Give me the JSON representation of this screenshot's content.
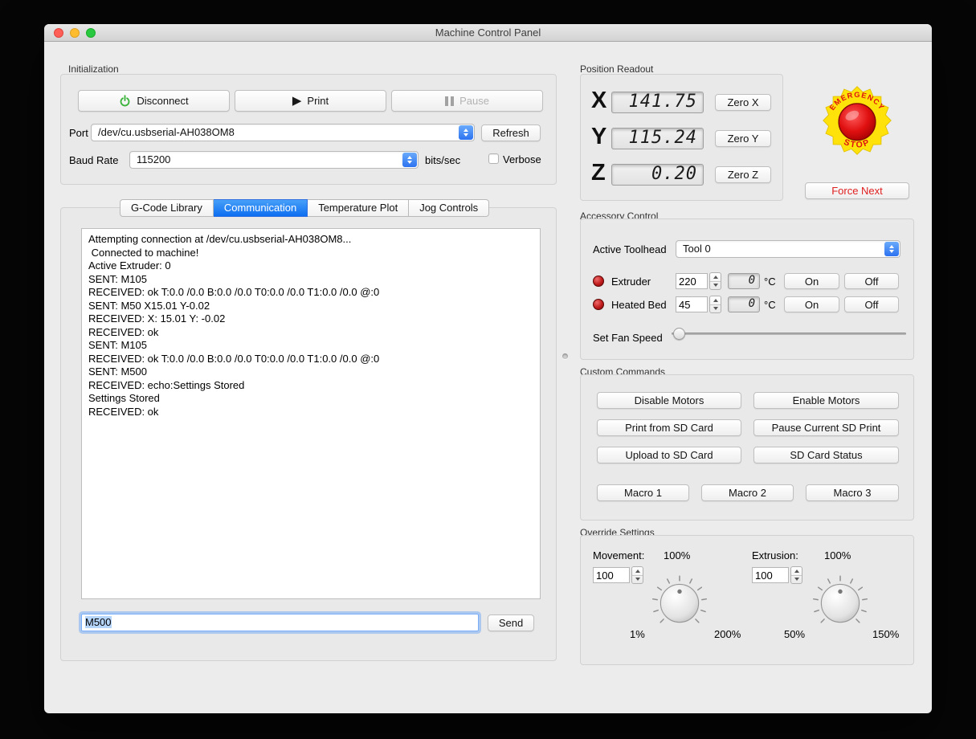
{
  "window": {
    "title": "Machine Control Panel"
  },
  "initialization": {
    "label": "Initialization",
    "disconnect_label": "Disconnect",
    "print_label": "Print",
    "pause_label": "Pause",
    "port_label": "Port",
    "port_value": "/dev/cu.usbserial-AH038OM8",
    "refresh_label": "Refresh",
    "baud_label": "Baud Rate",
    "baud_value": "115200",
    "baud_units": "bits/sec",
    "verbose_label": "Verbose"
  },
  "tabs": {
    "items": [
      {
        "label": "G-Code Library"
      },
      {
        "label": "Communication"
      },
      {
        "label": "Temperature Plot"
      },
      {
        "label": "Jog Controls"
      }
    ]
  },
  "console": {
    "log": "Attempting connection at /dev/cu.usbserial-AH038OM8...\n Connected to machine!\nActive Extruder: 0\nSENT: M105\nRECEIVED: ok T:0.0 /0.0 B:0.0 /0.0 T0:0.0 /0.0 T1:0.0 /0.0 @:0\nSENT: M50 X15.01 Y-0.02\nRECEIVED: X: 15.01 Y: -0.02\nRECEIVED: ok\nSENT: M105\nRECEIVED: ok T:0.0 /0.0 B:0.0 /0.0 T0:0.0 /0.0 T1:0.0 /0.0 @:0\nSENT: M500\nRECEIVED: echo:Settings Stored\nSettings Stored\nRECEIVED: ok",
    "command_value": "M500",
    "send_label": "Send"
  },
  "position": {
    "label": "Position Readout",
    "axes": [
      {
        "axis": "X",
        "value": "141.75",
        "zero_label": "Zero X"
      },
      {
        "axis": "Y",
        "value": "115.24",
        "zero_label": "Zero Y"
      },
      {
        "axis": "Z",
        "value": "0.20",
        "zero_label": "Zero Z"
      }
    ]
  },
  "emergency": {
    "top": "EMERGENCY",
    "bottom": "STOP"
  },
  "force_next_label": "Force Next",
  "accessory": {
    "label": "Accessory Control",
    "toolhead_label": "Active Toolhead",
    "toolhead_value": "Tool 0",
    "heaters": [
      {
        "name": "Extruder",
        "setpoint": "220",
        "current": "0",
        "unit": "°C",
        "on_label": "On",
        "off_label": "Off"
      },
      {
        "name": "Heated Bed",
        "setpoint": "45",
        "current": "0",
        "unit": "°C",
        "on_label": "On",
        "off_label": "Off"
      }
    ],
    "fan_label": "Set Fan Speed"
  },
  "custom_commands": {
    "label": "Custom Commands",
    "buttons": [
      {
        "label": "Disable Motors"
      },
      {
        "label": "Enable Motors"
      },
      {
        "label": "Print from SD Card"
      },
      {
        "label": "Pause Current SD Print"
      },
      {
        "label": "Upload to SD Card"
      },
      {
        "label": "SD Card Status"
      }
    ],
    "macros": [
      {
        "label": "Macro 1"
      },
      {
        "label": "Macro 2"
      },
      {
        "label": "Macro 3"
      }
    ]
  },
  "override": {
    "label": "Override Settings",
    "movement": {
      "label": "Movement:",
      "current": "100%",
      "value": "100",
      "min": "1%",
      "max": "200%"
    },
    "extrusion": {
      "label": "Extrusion:",
      "current": "100%",
      "value": "100",
      "min": "50%",
      "max": "150%"
    }
  },
  "colors": {
    "accent_blue": "#2c72f0",
    "selected_tab_blue": "#0d6ef0",
    "emergency_yellow": "#ffe20a",
    "emergency_red": "#d60000",
    "led_red": "#c01c1c",
    "force_next_red": "#e02020"
  }
}
